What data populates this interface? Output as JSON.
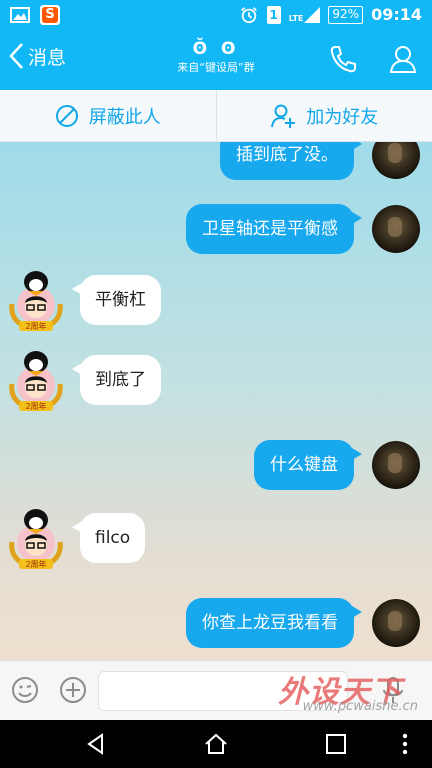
{
  "status_bar": {
    "sogou_label": "S",
    "sim_slot": "1",
    "network": "LTE",
    "battery": "92%",
    "time": "09:14"
  },
  "header": {
    "back_label": "消息",
    "title": "ʘ̆ ʘ",
    "subtitle": "来自“键设局”群"
  },
  "actions": {
    "block_label": "屏蔽此人",
    "add_friend_label": "加为好友"
  },
  "messages": [
    {
      "side": "out",
      "text": "插到底了没。"
    },
    {
      "side": "out",
      "text": "卫星轴还是平衡感"
    },
    {
      "side": "in",
      "text": "平衡杠"
    },
    {
      "side": "in",
      "text": "到底了"
    },
    {
      "side": "out",
      "text": "什么键盘"
    },
    {
      "side": "in",
      "text": "filco"
    },
    {
      "side": "out",
      "text": "你查上龙豆我看看"
    }
  ],
  "friend_badge": "2周年",
  "watermark": {
    "main": "外设天下",
    "sub": "www.pcwaishe.cn"
  },
  "colors": {
    "brand": "#12b7f5",
    "bubble_out": "#17a8ee",
    "bubble_in": "#ffffff",
    "action_text": "#12a7e8"
  }
}
